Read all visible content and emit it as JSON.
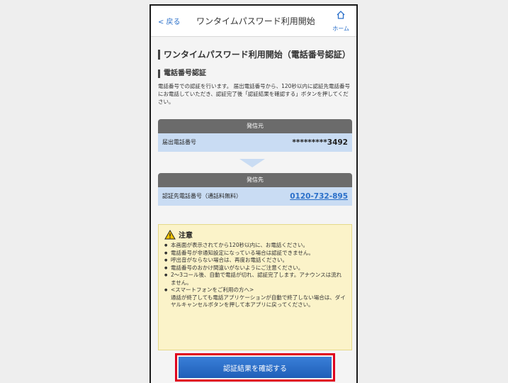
{
  "header": {
    "back_label": "< 戻る",
    "title": "ワンタイムパスワード利用開始",
    "home_label": "ホーム"
  },
  "section_title": "ワンタイムパスワード利用開始（電話番号認証）",
  "sub_title": "電話番号認証",
  "description": "電話番号での認証を行います。 届出電話番号から、120秒以内に認証先電話番号にお電話していただき、認証完了後「認証結果を確認する」ボタンを押してください。",
  "from_card": {
    "header": "発信元",
    "label": "届出電話番号",
    "value": "*********3492"
  },
  "to_card": {
    "header": "発信先",
    "label": "認証先電話番号（通話料無料）",
    "value": "0120-732-895"
  },
  "notice": {
    "title": "注意",
    "items": [
      "本画面が表示されてから120秒以内に、お電話ください。",
      "電話番号が非通知設定になっている場合は認証できません。",
      "呼出音がならない場合は、再度お電話ください。",
      "電話番号のおかけ間違いがないようにご注意ください。",
      "2〜3コール後、自動で電話が切れ、認証完了します。アナウンスは流れません。",
      "<スマートフォンをご利用の方へ>"
    ],
    "extra": "通話が終了しても電話アプリケーションが自動で終了しない場合は、ダイヤルキャンセルボタンを押して本アプリに戻ってください。"
  },
  "confirm_button": "認証結果を確認する",
  "colors": {
    "accent": "#2a6fc9",
    "card_header": "#6b6b6b",
    "card_body": "#c9dcf3",
    "notice_bg": "#fbf3c9",
    "highlight": "#e0001e"
  }
}
